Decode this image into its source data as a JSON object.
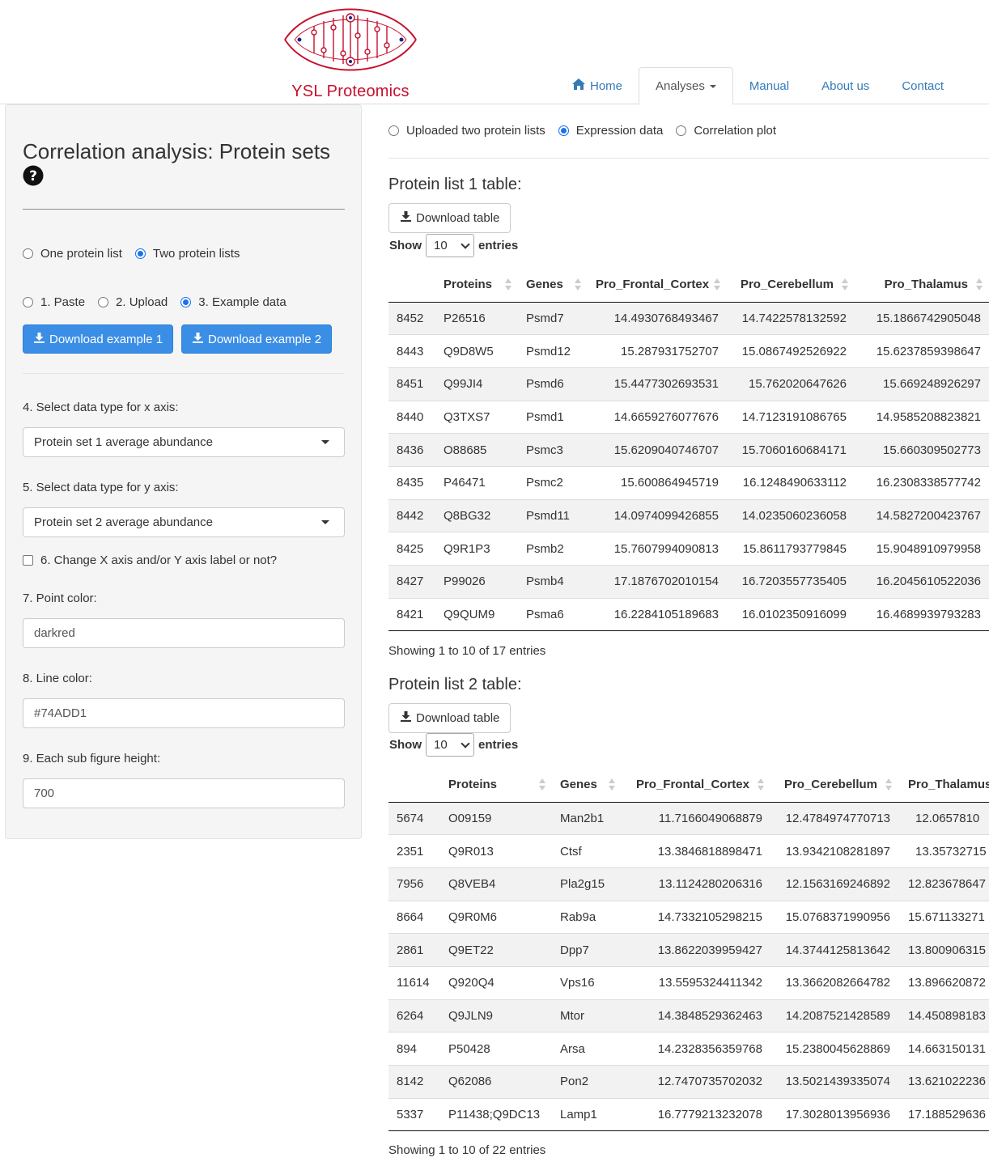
{
  "brand": {
    "name": "YSL Proteomics"
  },
  "nav": {
    "items": [
      {
        "label": "Home",
        "icon": "home-icon"
      },
      {
        "label": "Analyses",
        "active": true
      },
      {
        "label": "Manual"
      },
      {
        "label": "About us"
      },
      {
        "label": "Contact"
      }
    ]
  },
  "sidebar": {
    "title": "Correlation analysis: Protein sets",
    "list_mode": {
      "options": [
        "One protein list",
        "Two protein lists"
      ],
      "selected": "Two protein lists"
    },
    "input_mode": {
      "options": [
        "1. Paste",
        "2. Upload",
        "3. Example data"
      ],
      "selected": "3. Example data"
    },
    "download_example_1": "Download example 1",
    "download_example_2": "Download example 2",
    "x_axis": {
      "label": "4. Select data type for x axis:",
      "value": "Protein set 1 average abundance"
    },
    "y_axis": {
      "label": "5. Select data type for y axis:",
      "value": "Protein set 2 average abundance"
    },
    "change_label": {
      "label": "6. Change X axis and/or Y axis label or not?",
      "checked": false
    },
    "point_color": {
      "label": "7. Point color:",
      "value": "darkred"
    },
    "line_color": {
      "label": "8. Line color:",
      "value": "#74ADD1"
    },
    "sub_height": {
      "label": "9. Each sub figure height:",
      "value": "700"
    }
  },
  "main": {
    "tabs": {
      "options": [
        "Uploaded two protein lists",
        "Expression data",
        "Correlation plot"
      ],
      "selected": "Expression data"
    },
    "table1": {
      "title": "Protein list 1 table:",
      "download": "Download table",
      "show_label": "Show",
      "entries_label": "entries",
      "page_size": "10",
      "columns": [
        "Proteins",
        "Genes",
        "Pro_Frontal_Cortex",
        "Pro_Cerebellum",
        "Pro_Thalamus"
      ],
      "rows": [
        [
          "8452",
          "P26516",
          "Psmd7",
          "14.4930768493467",
          "14.7422578132592",
          "15.1866742905048"
        ],
        [
          "8443",
          "Q9D8W5",
          "Psmd12",
          "15.287931752707",
          "15.0867492526922",
          "15.6237859398647"
        ],
        [
          "8451",
          "Q99JI4",
          "Psmd6",
          "15.4477302693531",
          "15.762020647626",
          "15.669248926297"
        ],
        [
          "8440",
          "Q3TXS7",
          "Psmd1",
          "14.6659276077676",
          "14.7123191086765",
          "14.9585208823821"
        ],
        [
          "8436",
          "O88685",
          "Psmc3",
          "15.6209040746707",
          "15.7060160684171",
          "15.660309502773"
        ],
        [
          "8435",
          "P46471",
          "Psmc2",
          "15.600864945719",
          "16.1248490633112",
          "16.2308338577742"
        ],
        [
          "8442",
          "Q8BG32",
          "Psmd11",
          "14.0974099426855",
          "14.0235060236058",
          "14.5827200423767"
        ],
        [
          "8425",
          "Q9R1P3",
          "Psmb2",
          "15.7607994090813",
          "15.8611793779845",
          "15.9048910979958"
        ],
        [
          "8427",
          "P99026",
          "Psmb4",
          "17.1876702010154",
          "16.7203557735405",
          "16.2045610522036"
        ],
        [
          "8421",
          "Q9QUM9",
          "Psma6",
          "16.2284105189683",
          "16.0102350916099",
          "16.4689939793283"
        ]
      ],
      "info": "Showing 1 to 10 of 17 entries"
    },
    "table2": {
      "title": "Protein list 2 table:",
      "download": "Download table",
      "show_label": "Show",
      "entries_label": "entries",
      "page_size": "10",
      "columns": [
        "Proteins",
        "Genes",
        "Pro_Frontal_Cortex",
        "Pro_Cerebellum",
        "Pro_Thalamus"
      ],
      "rows": [
        [
          "5674",
          "O09159",
          "Man2b1",
          "11.7166049068879",
          "12.4784974770713",
          "12.0657810"
        ],
        [
          "2351",
          "Q9R013",
          "Ctsf",
          "13.3846818898471",
          "13.9342108281897",
          "13.35732715"
        ],
        [
          "7956",
          "Q8VEB4",
          "Pla2g15",
          "13.1124280206316",
          "12.1563169246892",
          "12.823678647"
        ],
        [
          "8664",
          "Q9R0M6",
          "Rab9a",
          "14.7332105298215",
          "15.0768371990956",
          "15.671133271"
        ],
        [
          "2861",
          "Q9ET22",
          "Dpp7",
          "13.8622039959427",
          "14.3744125813642",
          "13.800906315"
        ],
        [
          "11614",
          "Q920Q4",
          "Vps16",
          "13.5595324411342",
          "13.3662082664782",
          "13.896620872"
        ],
        [
          "6264",
          "Q9JLN9",
          "Mtor",
          "14.3848529362463",
          "14.2087521428589",
          "14.450898183"
        ],
        [
          "894",
          "P50428",
          "Arsa",
          "14.2328356359768",
          "15.2380045628869",
          "14.663150131"
        ],
        [
          "8142",
          "Q62086",
          "Pon2",
          "12.7470735702032",
          "13.5021439335074",
          "13.621022236"
        ],
        [
          "5337",
          "P11438;Q9DC13",
          "Lamp1",
          "16.7779213232078",
          "17.3028013956936",
          "17.188529636"
        ]
      ],
      "info": "Showing 1 to 10 of 22 entries"
    }
  },
  "colors": {
    "accent": "#337ab7",
    "brand": "#c8102e",
    "button_primary": "#3a8ee6"
  }
}
